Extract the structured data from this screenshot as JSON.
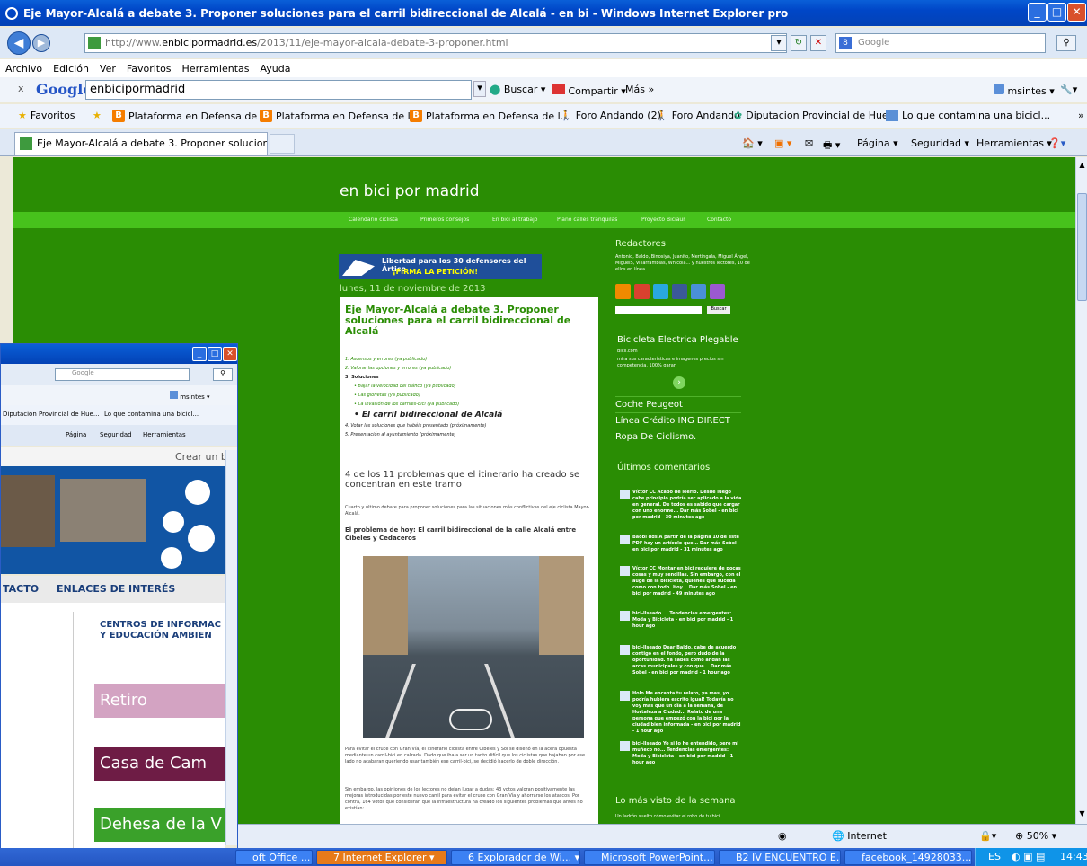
{
  "window": {
    "title": "Eje Mayor-Alcalá a debate 3. Proponer soluciones para el carril bidireccional de Alcalá - en bi - Windows Internet Explorer pro",
    "url_prefix": "http://www.",
    "url_domain": "enbicipormadrid.es",
    "url_path": "/2013/11/eje-mayor-alcala-debate-3-proponer.html",
    "search_placeholder": "Google"
  },
  "menu": [
    "Archivo",
    "Edición",
    "Ver",
    "Favoritos",
    "Herramientas",
    "Ayuda"
  ],
  "google_bar": {
    "close": "x",
    "logo": "Google",
    "query": "enbicipormadrid",
    "search_label": "Buscar",
    "share_label": "Compartir",
    "more_label": "Más »",
    "user": "msintes"
  },
  "favorites": {
    "label": "Favoritos",
    "items": [
      "Plataforma en Defensa de l...",
      "Plataforma en Defensa de l...",
      "Plataforma en Defensa de l...",
      "Foro Andando (2)",
      "Foro Andando",
      "Diputacion Provincial de Hue...",
      "Lo que contamina una bicicl..."
    ]
  },
  "tab": {
    "label": "Eje Mayor-Alcalá a debate 3. Proponer soluciones par...",
    "cmd_page": "Página",
    "cmd_security": "Seguridad",
    "cmd_tools": "Herramientas"
  },
  "blog": {
    "title": "en bici por madrid",
    "nav": [
      "Calendario ciclista",
      "Primeros consejos",
      "En bici al trabajo",
      "Plano calles tranquilas",
      "Proyecto Biciaur",
      "Contacto"
    ],
    "ad_line1": "Libertad para los 30 defensores del Ártico",
    "ad_line2": "¡FIRMA LA PETICIÓN!",
    "date": "lunes, 11 de noviembre de 2013",
    "post_title": "Eje Mayor-Alcalá a debate 3. Proponer soluciones para el carril bidireccional de Alcalá",
    "list": [
      "1. Ascensos y errores (ya publicado)",
      "2. Valorar las opciones y errores (ya publicado)",
      "3. Soluciones",
      "• Bajar la velocidad del tráfico (ya publicado)",
      "• Las glorietas (ya publicado)",
      "• La invasión de los carriles-bici (ya publicado)",
      "• El carril bidireccional de Alcalá",
      "4. Votar las soluciones que habéis presentado (próximamente)",
      "5. Presentación al ayuntamiento (próximamente)"
    ],
    "subheading": "4 de los 11 problemas que el itinerario ha creado se concentran en este tramo",
    "intro": "Cuarto y último debate para proponer soluciones para las situaciones más conflictivas del eje ciclista Mayor-Alcalá.",
    "problem": "El problema de hoy: El carril bidireccional de la calle Alcalá entre Cibeles y Cedaceros",
    "para1": "Para evitar el cruce con Gran Vía, el itinerario ciclista entre Cibeles y Sol se diseñó en la acera opuesta mediante un carril-bici en calzada. Dado que iba a ser un tanto difícil que los ciclistas que bajaban por ese lado no acabaran queriendo usar también ese carril-bici, se decidió hacerlo de doble dirección.",
    "para2": "Sin embargo, las opiniones de los lectores no dejan lugar a dudas: 43 votos valoran positivamente las mejoras introducidas por este nuevo carril para evitar el cruce con Gran Vía y ahorrarse los atascos. Por contra, 164 votos que consideran que la infraestructura ha creado los siguientes problemas que antes no existían:"
  },
  "sidebar": {
    "redactores_title": "Redactores",
    "redactores_text": "Antonio, Baldo, Binosiya, Juanito, Mertingala, Miguel Ángel, MiguelS, Villarramblas, Whicola... y nuestros lectores, 10 de ellos en línea",
    "search_button": "Buscar",
    "ad_title": "Bicicleta Electrica Plegable",
    "ad_domain": "Bicli.com",
    "ad_text": "mira sus características e imagenes precios sin competencia. 100% garan",
    "links": [
      "Coche Peugeot",
      "Línea Crédito ING DIRECT",
      "Ropa De Ciclismo."
    ],
    "comments_title": "Últimos comentarios",
    "comments": [
      "Víctor CC Acabo de leerlo. Desde luego cabe principio podría ser aplicado a la vida en general. De todos es sabido que cargar con uno enorme... Dar más Sobel - en bici por madrid - 30 minutes ago",
      "Baobi dds A partir de la página 10 de este PDF hay un artículo que... Dar más Sobel - en bici por madrid - 31 minutes ago",
      "Víctor CC Montar en bici requiere de pocas cosas y muy sencillas. Sin embargo, con el auge de la bicicleta, quienes que suceda como con todo. Hoy... Dar más Sobel - en bici por madrid - 49 minutes ago",
      "bici-llseado ... Tendencias emergentes: Moda y Bicicleta - en bici por madrid - 1 hour ago",
      "bici-llseado Dear Baldo, cabe de acuerdo contigo en el fondo, pero dudo de la oportunidad. Ya sabes como andan las arcas municipales y con que... Dar más Sobel - en bici por madrid - 1 hour ago",
      "Holo Me encanta tu relato, ya mas, yo podría hubiera escrito igual! Todavía no voy mas que un día a la semana, de Hortaleza a Ciudad... Relato de una persona que empezó con la bici por la ciudad bien informada - en bici por madrid - 1 hour ago",
      "bici-llseado Yo si lo he entendido, pero mi muñeco no... Tendencias emergentes: Moda y Bicicleta - en bici por madrid - 1 hour ago"
    ],
    "most_viewed_title": "Lo más visto de la semana",
    "most_viewed_first": "Un ladrón suelto cómo evitar el robo de tu bici"
  },
  "status": {
    "zone": "Internet",
    "zoom": "50%"
  },
  "popup": {
    "search_placeholder": "Google",
    "user": "msintes",
    "fav1": "Diputacion Provincial de Hue...",
    "fav2": "Lo que contamina una bicicl...",
    "cmd_page": "Página",
    "cmd_security": "Seguridad",
    "cmd_tools": "Herramientas",
    "create_blog": "Crear un blo",
    "menu1": "TACTO",
    "menu2": "ENLACES DE INTERÉS",
    "banner_top_a": "CENTROS DE INFORMAC",
    "banner_top_b": "Y EDUCACIÓN AMBIEN",
    "banner_retiro": "Retiro",
    "banner_casa": "Casa de Cam",
    "banner_dehesa": "Dehesa de la V"
  },
  "taskbar": {
    "items": [
      "oft Office ...",
      "7 Internet Explorer",
      "6 Explorador de Wi...",
      "Microsoft PowerPoint...",
      "B2 IV ENCUENTRO E...",
      "facebook_14928033..."
    ],
    "lang": "ES",
    "time": "14:43"
  },
  "colors": {
    "blog_bg": "#2a8d04",
    "nav_strip": "#47c21c",
    "titlebar": "#0046c7",
    "post_title": "#2a8d04"
  }
}
